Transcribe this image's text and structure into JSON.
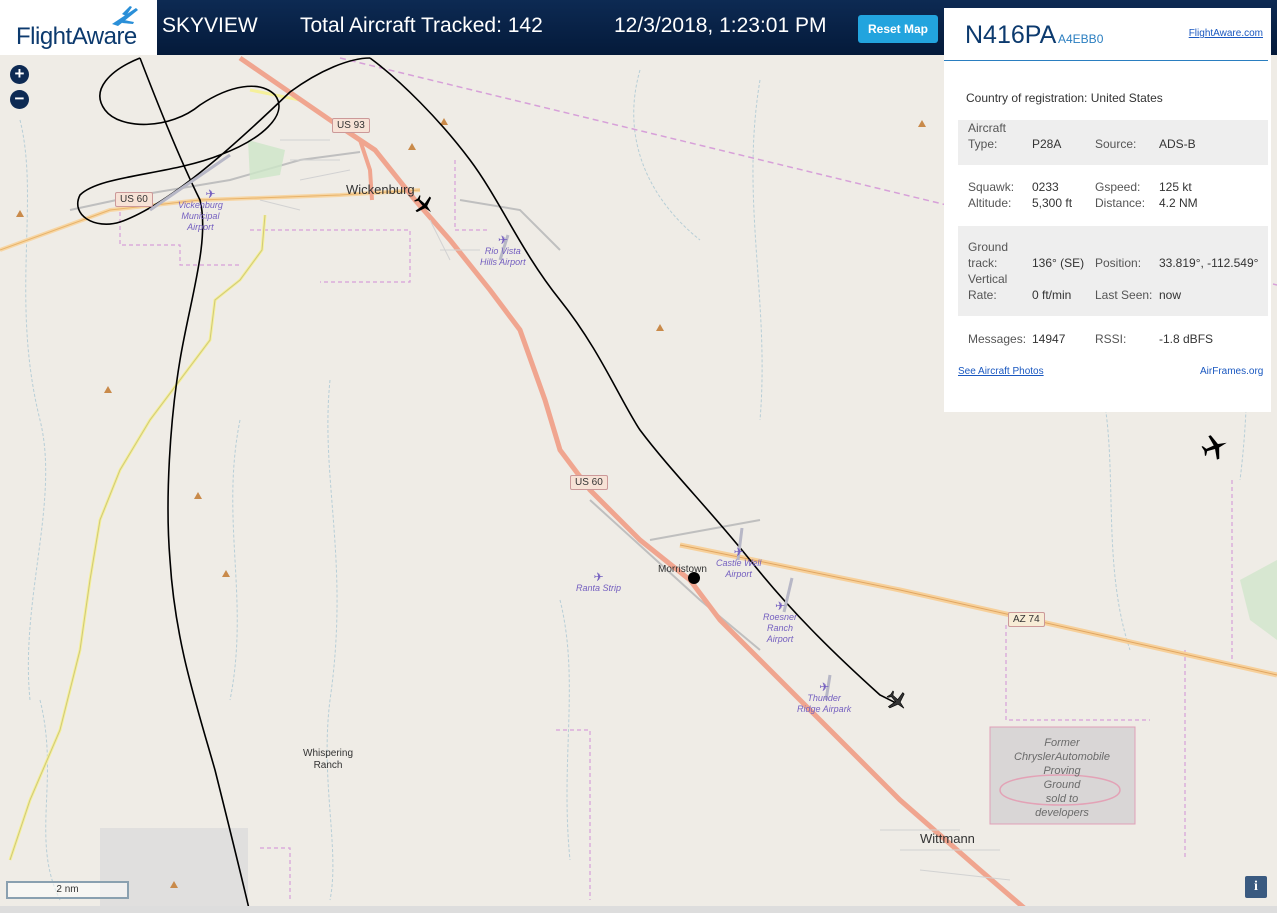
{
  "header": {
    "brand": "FlightAware",
    "app_name": "SKYVIEW",
    "total_tracked": "Total Aircraft Tracked: 142",
    "datetime": "12/3/2018, 1:23:01 PM",
    "reset_label": "Reset Map"
  },
  "map": {
    "zoom_in": "+",
    "zoom_out": "−",
    "scale_label": "2 nm",
    "info_label": "i",
    "places": {
      "wickenburg": "Wickenburg",
      "morristown": "Morristown",
      "wittmann": "Wittmann",
      "whispering_1": "Whispering",
      "whispering_2": "Ranch"
    },
    "roads": {
      "us93": "US 93",
      "us60_a": "US 60",
      "us60_b": "US 60",
      "az74": "AZ 74"
    },
    "airports": {
      "wick_1": "Vickenburg",
      "wick_2": "Municipal",
      "wick_3": "Airport",
      "rio_1": "Rio Vista",
      "rio_2": "Hills Airport",
      "castle_1": "Castle Well",
      "castle_2": "Airport",
      "ranta": "Ranta Strip",
      "roesner_1": "Roesner",
      "roesner_2": "Ranch",
      "roesner_3": "Airport",
      "thunder_1": "Thunder",
      "thunder_2": "Ridge Airpark"
    },
    "former": [
      "Former",
      "ChryslerAutomobile",
      "Proving",
      "Ground",
      "sold to",
      "developers"
    ]
  },
  "panel": {
    "registration": "N416PA",
    "hex": "A4EBB0",
    "fa_link": "FlightAware.com",
    "country_label": "Country of registration:",
    "country_value": "United States",
    "aircraft_type_label_1": "Aircraft",
    "aircraft_type_label_2": "Type:",
    "aircraft_type": "P28A",
    "source_label": "Source:",
    "source": "ADS-B",
    "squawk_label": "Squawk:",
    "squawk": "0233",
    "gspeed_label": "Gspeed:",
    "gspeed": "125 kt",
    "altitude_label": "Altitude:",
    "altitude": "5,300 ft",
    "distance_label": "Distance:",
    "distance": "4.2 NM",
    "ground_label_1": "Ground",
    "ground_label_2": "track:",
    "ground_track": "136° (SE)",
    "position_label": "Position:",
    "position": "33.819°, -112.549°",
    "vrate_label_1": "Vertical",
    "vrate_label_2": "Rate:",
    "vertical_rate": "0 ft/min",
    "lastseen_label": "Last Seen:",
    "last_seen": "now",
    "messages_label": "Messages:",
    "messages": "14947",
    "rssi_label": "RSSI:",
    "rssi": "-1.8 dBFS",
    "photos_link": "See Aircraft Photos",
    "airframes_link": "AirFrames.org"
  }
}
